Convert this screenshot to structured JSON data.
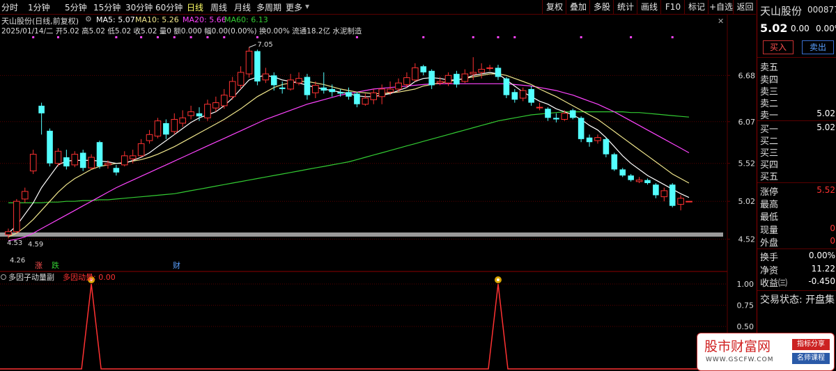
{
  "toolbar": {
    "periods": [
      "分时",
      "1分钟",
      "5分钟",
      "15分钟",
      "30分钟",
      "60分钟",
      "日线",
      "周线",
      "月线",
      "多周期",
      "更多"
    ],
    "active_period": "日线",
    "buttons": [
      "复权",
      "叠加",
      "多股",
      "统计",
      "画线",
      "F10",
      "标记",
      "+自选",
      "返回"
    ]
  },
  "header": {
    "title": "天山股份(日线,前复权)",
    "ma5": "MA5: 5.07",
    "ma10": "MA10: 5.26",
    "ma20": "MA20: 5.66",
    "ma60": "MA60: 6.13",
    "ohlc": "2025/01/14/二 开5.02 高5.02 低5.02 收5.02 量0 额0.000 幅0.00(0.00%) 换0.00% 流通18.2亿 水泥制造"
  },
  "annotations": {
    "high": "7.05",
    "low_a": "4.53",
    "low_b": "4.59",
    "low_c": "4.26",
    "tag_up": "涨",
    "tag_down": "跌",
    "tag_fin": "财"
  },
  "price_axis": [
    "6.68",
    "6.07",
    "5.52",
    "5.02",
    "4.52"
  ],
  "indicator": {
    "title": "多因子动量副",
    "series_label": "多因动量: 0.00",
    "axis": [
      "1.00",
      "0.75",
      "0.50"
    ]
  },
  "colors": {
    "up": "#ff3232",
    "down": "#54ffff",
    "ma5": "#ffffff",
    "ma10": "#f0e68c",
    "ma20": "#ff44ff",
    "ma60": "#33cc33",
    "grid": "#5a0000",
    "indicator_line": "#ff3232"
  },
  "chart_data": {
    "type": "candlestick",
    "title": "天山股份(日线,前复权)",
    "ylim": [
      4.26,
      7.05
    ],
    "candles": [
      {
        "o": 4.58,
        "c": 4.62,
        "h": 4.66,
        "l": 4.53
      },
      {
        "o": 4.62,
        "c": 5.02,
        "h": 5.05,
        "l": 4.6
      },
      {
        "o": 5.05,
        "c": 5.15,
        "h": 5.2,
        "l": 5.0
      },
      {
        "o": 5.42,
        "c": 5.64,
        "h": 5.7,
        "l": 5.38
      },
      {
        "o": 6.28,
        "c": 6.18,
        "h": 6.32,
        "l": 5.9
      },
      {
        "o": 5.95,
        "c": 5.52,
        "h": 5.98,
        "l": 5.48
      },
      {
        "o": 5.52,
        "c": 5.68,
        "h": 5.72,
        "l": 5.48
      },
      {
        "o": 5.6,
        "c": 5.48,
        "h": 5.7,
        "l": 5.44
      },
      {
        "o": 5.5,
        "c": 5.64,
        "h": 5.68,
        "l": 5.47
      },
      {
        "o": 5.66,
        "c": 5.46,
        "h": 5.7,
        "l": 5.42
      },
      {
        "o": 5.46,
        "c": 5.6,
        "h": 5.64,
        "l": 5.44
      },
      {
        "o": 5.8,
        "c": 5.48,
        "h": 5.82,
        "l": 5.45
      },
      {
        "o": 5.5,
        "c": 5.52,
        "h": 5.56,
        "l": 5.45
      },
      {
        "o": 5.46,
        "c": 5.4,
        "h": 5.5,
        "l": 5.36
      },
      {
        "o": 5.5,
        "c": 5.62,
        "h": 5.68,
        "l": 5.48
      },
      {
        "o": 5.58,
        "c": 5.62,
        "h": 5.7,
        "l": 5.52
      },
      {
        "o": 5.62,
        "c": 5.78,
        "h": 5.84,
        "l": 5.6
      },
      {
        "o": 5.82,
        "c": 5.9,
        "h": 5.96,
        "l": 5.78
      },
      {
        "o": 5.88,
        "c": 6.08,
        "h": 6.12,
        "l": 5.85
      },
      {
        "o": 6.05,
        "c": 5.9,
        "h": 6.1,
        "l": 5.84
      },
      {
        "o": 5.94,
        "c": 6.1,
        "h": 6.18,
        "l": 5.9
      },
      {
        "o": 6.05,
        "c": 6.12,
        "h": 6.22,
        "l": 6.0
      },
      {
        "o": 6.15,
        "c": 6.2,
        "h": 6.28,
        "l": 6.1
      },
      {
        "o": 6.18,
        "c": 6.14,
        "h": 6.26,
        "l": 6.08
      },
      {
        "o": 6.12,
        "c": 6.3,
        "h": 6.36,
        "l": 6.08
      },
      {
        "o": 6.25,
        "c": 6.32,
        "h": 6.4,
        "l": 6.2
      },
      {
        "o": 6.28,
        "c": 6.42,
        "h": 6.5,
        "l": 6.24
      },
      {
        "o": 6.4,
        "c": 6.6,
        "h": 6.66,
        "l": 6.36
      },
      {
        "o": 6.55,
        "c": 6.72,
        "h": 6.8,
        "l": 6.5
      },
      {
        "o": 6.7,
        "c": 7.0,
        "h": 7.05,
        "l": 6.65
      },
      {
        "o": 7.0,
        "c": 6.6,
        "h": 7.02,
        "l": 6.55
      },
      {
        "o": 6.62,
        "c": 6.7,
        "h": 6.78,
        "l": 6.58
      },
      {
        "o": 6.68,
        "c": 6.55,
        "h": 6.72,
        "l": 6.48
      },
      {
        "o": 6.52,
        "c": 6.5,
        "h": 6.6,
        "l": 6.44
      },
      {
        "o": 6.5,
        "c": 6.62,
        "h": 6.7,
        "l": 6.48
      },
      {
        "o": 6.58,
        "c": 6.64,
        "h": 6.72,
        "l": 6.55
      },
      {
        "o": 6.66,
        "c": 6.42,
        "h": 6.7,
        "l": 6.36
      },
      {
        "o": 6.45,
        "c": 6.55,
        "h": 6.6,
        "l": 6.38
      },
      {
        "o": 6.52,
        "c": 6.48,
        "h": 6.72,
        "l": 6.44
      },
      {
        "o": 6.5,
        "c": 6.46,
        "h": 6.56,
        "l": 6.4
      },
      {
        "o": 6.46,
        "c": 6.44,
        "h": 6.5,
        "l": 6.4
      },
      {
        "o": 6.46,
        "c": 6.4,
        "h": 6.52,
        "l": 6.36
      },
      {
        "o": 6.44,
        "c": 6.3,
        "h": 6.46,
        "l": 6.26
      },
      {
        "o": 6.3,
        "c": 6.38,
        "h": 6.44,
        "l": 6.28
      },
      {
        "o": 6.36,
        "c": 6.45,
        "h": 6.5,
        "l": 6.3
      },
      {
        "o": 6.4,
        "c": 6.5,
        "h": 6.56,
        "l": 6.3
      },
      {
        "o": 6.46,
        "c": 6.5,
        "h": 6.6,
        "l": 6.42
      },
      {
        "o": 6.5,
        "c": 6.58,
        "h": 6.64,
        "l": 6.46
      },
      {
        "o": 6.56,
        "c": 6.65,
        "h": 6.72,
        "l": 6.52
      },
      {
        "o": 6.62,
        "c": 6.78,
        "h": 6.84,
        "l": 6.6
      },
      {
        "o": 6.8,
        "c": 6.72,
        "h": 6.82,
        "l": 6.68
      },
      {
        "o": 6.74,
        "c": 6.55,
        "h": 6.76,
        "l": 6.5
      },
      {
        "o": 6.58,
        "c": 6.6,
        "h": 6.66,
        "l": 6.55
      },
      {
        "o": 6.58,
        "c": 6.68,
        "h": 6.72,
        "l": 6.54
      },
      {
        "o": 6.7,
        "c": 6.56,
        "h": 6.74,
        "l": 6.52
      },
      {
        "o": 6.6,
        "c": 6.7,
        "h": 6.76,
        "l": 6.58
      },
      {
        "o": 6.7,
        "c": 6.72,
        "h": 6.92,
        "l": 6.62
      },
      {
        "o": 6.72,
        "c": 6.76,
        "h": 6.84,
        "l": 6.64
      },
      {
        "o": 6.78,
        "c": 6.78,
        "h": 6.82,
        "l": 6.74
      },
      {
        "o": 6.78,
        "c": 6.66,
        "h": 6.82,
        "l": 6.62
      },
      {
        "o": 6.64,
        "c": 6.42,
        "h": 6.66,
        "l": 6.38
      },
      {
        "o": 6.46,
        "c": 6.36,
        "h": 6.5,
        "l": 6.32
      },
      {
        "o": 6.38,
        "c": 6.48,
        "h": 6.52,
        "l": 6.34
      },
      {
        "o": 6.5,
        "c": 6.32,
        "h": 6.54,
        "l": 6.28
      },
      {
        "o": 6.26,
        "c": 6.26,
        "h": 6.32,
        "l": 6.22
      },
      {
        "o": 6.24,
        "c": 6.12,
        "h": 6.26,
        "l": 6.08
      },
      {
        "o": 6.12,
        "c": 6.1,
        "h": 6.18,
        "l": 6.06
      },
      {
        "o": 6.1,
        "c": 6.18,
        "h": 6.22,
        "l": 6.08
      },
      {
        "o": 6.22,
        "c": 6.12,
        "h": 6.24,
        "l": 6.1
      },
      {
        "o": 6.12,
        "c": 5.84,
        "h": 6.14,
        "l": 5.8
      },
      {
        "o": 5.86,
        "c": 5.8,
        "h": 5.9,
        "l": 5.74
      },
      {
        "o": 5.82,
        "c": 5.86,
        "h": 5.9,
        "l": 5.78
      },
      {
        "o": 5.84,
        "c": 5.64,
        "h": 5.86,
        "l": 5.6
      },
      {
        "o": 5.64,
        "c": 5.44,
        "h": 5.66,
        "l": 5.42
      },
      {
        "o": 5.44,
        "c": 5.36,
        "h": 5.46,
        "l": 5.34
      },
      {
        "o": 5.36,
        "c": 5.3,
        "h": 5.38,
        "l": 5.28
      },
      {
        "o": 5.28,
        "c": 5.3,
        "h": 5.34,
        "l": 5.26
      },
      {
        "o": 5.3,
        "c": 5.26,
        "h": 5.32,
        "l": 5.24
      },
      {
        "o": 5.24,
        "c": 5.1,
        "h": 5.26,
        "l": 5.06
      },
      {
        "o": 5.08,
        "c": 5.16,
        "h": 5.2,
        "l": 5.02
      },
      {
        "o": 5.24,
        "c": 4.96,
        "h": 5.26,
        "l": 4.94
      },
      {
        "o": 4.98,
        "c": 5.06,
        "h": 5.1,
        "l": 4.9
      },
      {
        "o": 5.02,
        "c": 5.02,
        "h": 5.02,
        "l": 5.02
      }
    ],
    "ma5": [
      4.6,
      4.7,
      4.85,
      5.0,
      5.2,
      5.35,
      5.5,
      5.55,
      5.56,
      5.56,
      5.56,
      5.55,
      5.54,
      5.52,
      5.52,
      5.56,
      5.6,
      5.66,
      5.74,
      5.82,
      5.9,
      5.98,
      6.06,
      6.12,
      6.16,
      6.2,
      6.28,
      6.38,
      6.5,
      6.62,
      6.66,
      6.68,
      6.66,
      6.62,
      6.6,
      6.58,
      6.55,
      6.52,
      6.5,
      6.48,
      6.46,
      6.44,
      6.41,
      6.4,
      6.4,
      6.42,
      6.44,
      6.48,
      6.52,
      6.6,
      6.64,
      6.65,
      6.64,
      6.62,
      6.62,
      6.64,
      6.68,
      6.7,
      6.72,
      6.7,
      6.62,
      6.54,
      6.46,
      6.4,
      6.34,
      6.3,
      6.24,
      6.2,
      6.16,
      6.1,
      6.02,
      5.96,
      5.86,
      5.74,
      5.62,
      5.52,
      5.44,
      5.36,
      5.3,
      5.24,
      5.18,
      5.12,
      5.07
    ],
    "ma10": [
      4.55,
      4.6,
      4.68,
      4.78,
      4.9,
      5.02,
      5.14,
      5.24,
      5.32,
      5.38,
      5.44,
      5.48,
      5.5,
      5.52,
      5.53,
      5.55,
      5.57,
      5.6,
      5.64,
      5.69,
      5.74,
      5.8,
      5.86,
      5.92,
      5.98,
      6.04,
      6.1,
      6.17,
      6.24,
      6.32,
      6.4,
      6.46,
      6.52,
      6.56,
      6.58,
      6.6,
      6.6,
      6.58,
      6.56,
      6.53,
      6.5,
      6.48,
      6.46,
      6.45,
      6.44,
      6.44,
      6.45,
      6.46,
      6.48,
      6.5,
      6.54,
      6.56,
      6.58,
      6.6,
      6.62,
      6.64,
      6.66,
      6.68,
      6.7,
      6.7,
      6.68,
      6.64,
      6.6,
      6.56,
      6.5,
      6.45,
      6.4,
      6.34,
      6.28,
      6.22,
      6.16,
      6.1,
      6.02,
      5.94,
      5.86,
      5.78,
      5.7,
      5.62,
      5.54,
      5.46,
      5.38,
      5.32,
      5.26
    ],
    "ma20": [
      4.5,
      4.52,
      4.55,
      4.6,
      4.66,
      4.72,
      4.78,
      4.84,
      4.9,
      4.96,
      5.02,
      5.08,
      5.14,
      5.2,
      5.25,
      5.3,
      5.35,
      5.4,
      5.45,
      5.5,
      5.55,
      5.6,
      5.65,
      5.7,
      5.75,
      5.8,
      5.85,
      5.9,
      5.95,
      6.0,
      6.05,
      6.1,
      6.14,
      6.18,
      6.22,
      6.26,
      6.3,
      6.33,
      6.36,
      6.39,
      6.42,
      6.44,
      6.46,
      6.48,
      6.5,
      6.51,
      6.52,
      6.53,
      6.54,
      6.55,
      6.56,
      6.57,
      6.57,
      6.57,
      6.57,
      6.57,
      6.57,
      6.57,
      6.57,
      6.57,
      6.57,
      6.56,
      6.55,
      6.54,
      6.52,
      6.5,
      6.48,
      6.45,
      6.42,
      6.38,
      6.34,
      6.3,
      6.25,
      6.2,
      6.14,
      6.08,
      6.02,
      5.96,
      5.9,
      5.84,
      5.78,
      5.72,
      5.66
    ],
    "ma60": [
      5.0,
      5.0,
      5.0,
      5.0,
      5.0,
      5.01,
      5.01,
      5.02,
      5.02,
      5.03,
      5.03,
      5.04,
      5.04,
      5.05,
      5.06,
      5.07,
      5.08,
      5.09,
      5.1,
      5.11,
      5.12,
      5.14,
      5.16,
      5.18,
      5.2,
      5.22,
      5.24,
      5.26,
      5.28,
      5.3,
      5.32,
      5.34,
      5.36,
      5.38,
      5.4,
      5.42,
      5.44,
      5.46,
      5.48,
      5.5,
      5.52,
      5.54,
      5.57,
      5.6,
      5.63,
      5.66,
      5.69,
      5.72,
      5.75,
      5.78,
      5.81,
      5.84,
      5.87,
      5.9,
      5.93,
      5.96,
      5.99,
      6.02,
      6.05,
      6.08,
      6.1,
      6.12,
      6.14,
      6.16,
      6.17,
      6.18,
      6.19,
      6.2,
      6.2,
      6.2,
      6.2,
      6.2,
      6.2,
      6.2,
      6.2,
      6.19,
      6.19,
      6.18,
      6.17,
      6.16,
      6.15,
      6.14,
      6.13
    ],
    "indicator": {
      "name": "多因动量",
      "ylim": [
        0,
        1.0
      ],
      "peaks": [
        {
          "index": 10,
          "value": 1.0
        },
        {
          "index": 59,
          "value": 1.0
        }
      ]
    }
  },
  "sidebar": {
    "name": "天山股份",
    "code": "000877",
    "price": "5.02",
    "change": "0.00",
    "change_pct": "0.00%",
    "buy_label": "买入",
    "sell_label": "卖出",
    "asks": [
      {
        "label": "卖五",
        "value": ""
      },
      {
        "label": "卖四",
        "value": ""
      },
      {
        "label": "卖三",
        "value": ""
      },
      {
        "label": "卖二",
        "value": ""
      },
      {
        "label": "卖一",
        "value": "5.02"
      }
    ],
    "bids": [
      {
        "label": "买一",
        "value": "5.02"
      },
      {
        "label": "买二",
        "value": ""
      },
      {
        "label": "买三",
        "value": ""
      },
      {
        "label": "买四",
        "value": ""
      },
      {
        "label": "买五",
        "value": ""
      }
    ],
    "stats": [
      {
        "label": "涨停",
        "value": "5.52",
        "color": "#ff3232"
      },
      {
        "label": "最高",
        "value": "",
        "color": "#e0e0e0"
      },
      {
        "label": "最低",
        "value": "",
        "color": "#e0e0e0"
      },
      {
        "label": "现量",
        "value": "0",
        "color": "#ff3232"
      },
      {
        "label": "外盘",
        "value": "0",
        "color": "#ff3232"
      }
    ],
    "stats2": [
      {
        "label": "换手",
        "value": "0.00%"
      },
      {
        "label": "净资",
        "value": "11.22"
      },
      {
        "label": "收益㈢",
        "value": "-0.450"
      }
    ],
    "trade_status": "交易状态: 开盘集"
  },
  "watermark": {
    "title": "股市财富网",
    "url": "WWW.GSCFW.COM",
    "tag1": "指标分享",
    "tag2": "名师课程"
  }
}
